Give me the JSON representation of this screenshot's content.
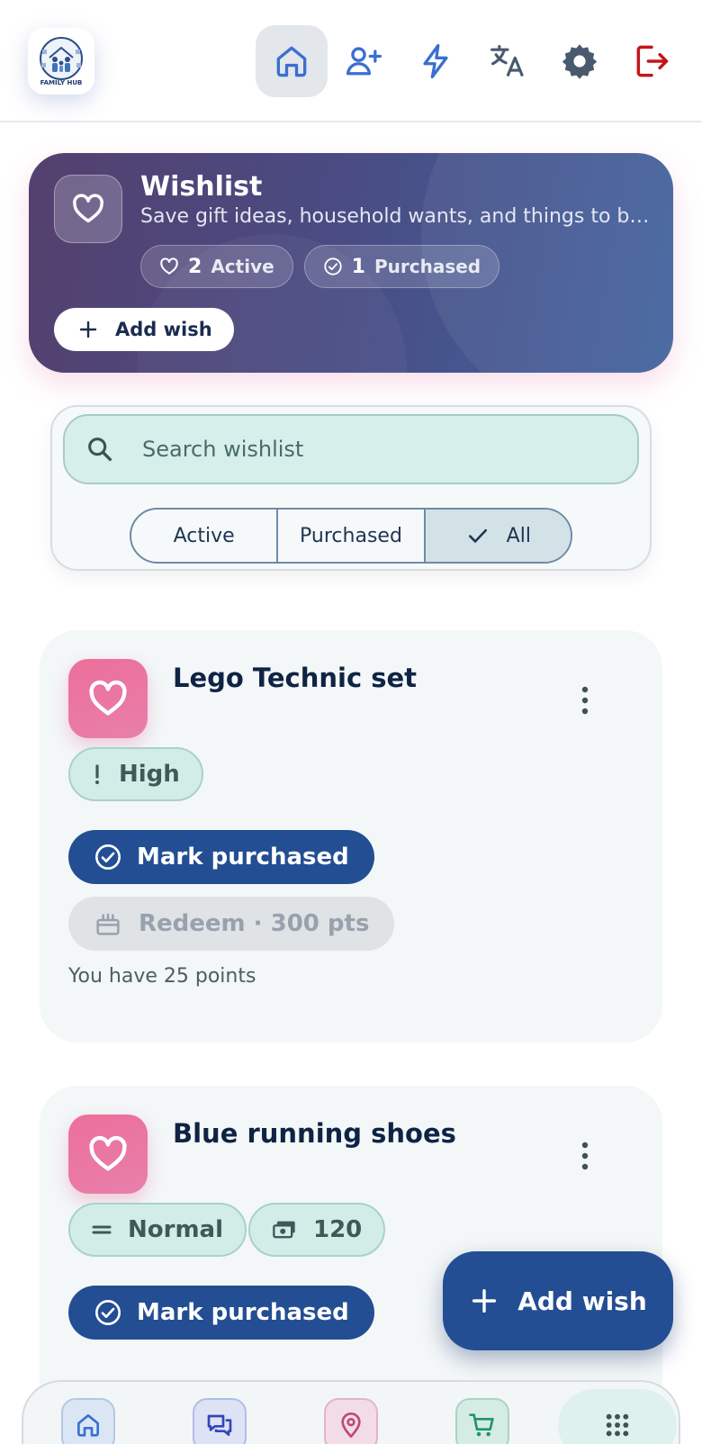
{
  "app": {
    "logo_text": "FAMILY HUB"
  },
  "top_nav": {
    "icons": [
      "home-icon",
      "add-member-icon",
      "bolt-icon",
      "translate-icon",
      "settings-icon",
      "logout-icon"
    ],
    "active": "home-icon",
    "colors": {
      "icon": "#3a6fd0",
      "logout": "#c3161c",
      "active_bg": "#e3e6ea"
    }
  },
  "hero": {
    "title": "Wishlist",
    "subtitle": "Save gift ideas, household wants, and things to buy later",
    "active_count": "2",
    "active_label": "Active",
    "purchased_count": "1",
    "purchased_label": "Purchased",
    "add_label": "Add wish"
  },
  "search": {
    "placeholder": "Search wishlist"
  },
  "filters": {
    "options": [
      "Active",
      "Purchased",
      "All"
    ],
    "selected": "All"
  },
  "items": [
    {
      "title": "Lego Technic set",
      "priority": "High",
      "priority_icon": "exclamation-icon",
      "mark_label": "Mark purchased",
      "redeem_label": "Redeem · 300 pts",
      "points_note": "You have 25 points"
    },
    {
      "title": "Blue running shoes",
      "priority": "Normal",
      "priority_icon": "equals-icon",
      "price": "120",
      "price_icon": "money-icon",
      "mark_label": "Mark purchased"
    }
  ],
  "fab": {
    "label": "Add wish"
  },
  "bottom_nav": {
    "icons": [
      "home-icon",
      "chat-icon",
      "location-icon",
      "cart-icon",
      "apps-grid-icon"
    ],
    "active": "apps-grid-icon"
  },
  "colors": {
    "primary": "#234e93",
    "accent_pink": "#ec6f99",
    "chip_teal": "#d2ede8",
    "hero_start": "#54406e",
    "hero_end": "#41639e"
  }
}
